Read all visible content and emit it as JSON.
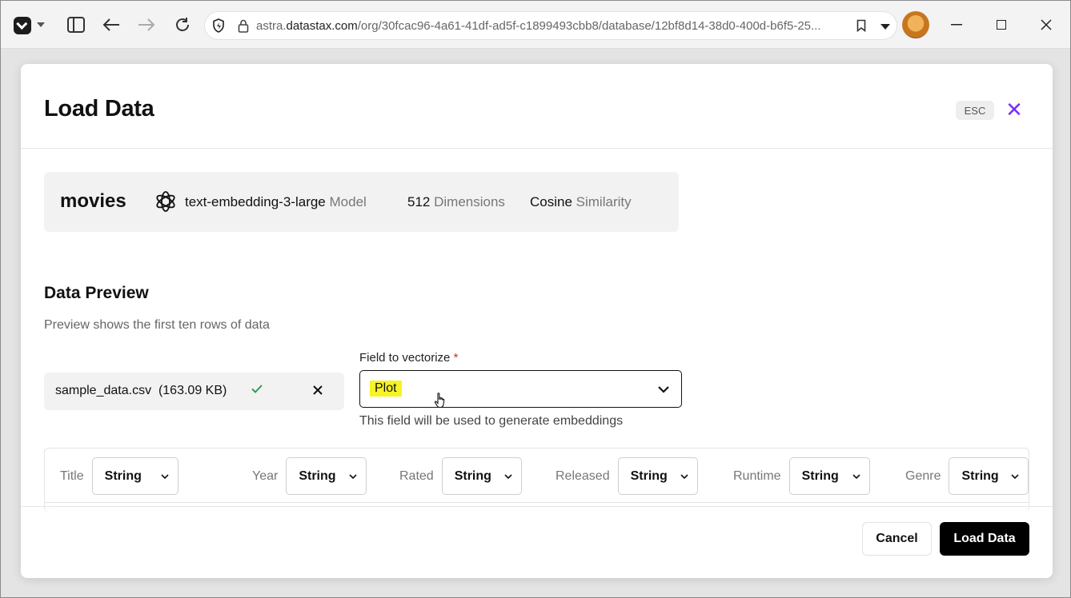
{
  "browser": {
    "url_prefix": "astra.",
    "url_host": "datastax.com",
    "url_path": "/org/30fcac96-4a61-41df-ad5f-c1899493cbb8/database/12bf8d14-38d0-400d-b6f5-25..."
  },
  "modal": {
    "title": "Load Data",
    "esc_label": "ESC",
    "close_symbol": "✕"
  },
  "info": {
    "collection": "movies",
    "model_name": "text-embedding-3-large",
    "model_suffix": "Model",
    "dimensions_value": "512",
    "dimensions_suffix": "Dimensions",
    "similarity_value": "Cosine",
    "similarity_suffix": "Similarity"
  },
  "preview": {
    "title": "Data Preview",
    "subtitle": "Preview shows the first ten rows of data",
    "file_name": "sample_data.csv",
    "file_size": "(163.09 KB)"
  },
  "vectorize": {
    "label": "Field to vectorize",
    "required_mark": "*",
    "value": "Plot",
    "help": "This field will be used to generate embeddings"
  },
  "columns": [
    {
      "name": "Title",
      "type": "String"
    },
    {
      "name": "Year",
      "type": "String"
    },
    {
      "name": "Rated",
      "type": "String"
    },
    {
      "name": "Released",
      "type": "String"
    },
    {
      "name": "Runtime",
      "type": "String"
    },
    {
      "name": "Genre",
      "type": "String"
    }
  ],
  "footer": {
    "cancel_label": "Cancel",
    "load_label": "Load Data"
  },
  "colors": {
    "accent_close": "#7b2ff7",
    "highlight": "#f7f326",
    "success": "#2e9a52",
    "primary_button": "#000000"
  }
}
